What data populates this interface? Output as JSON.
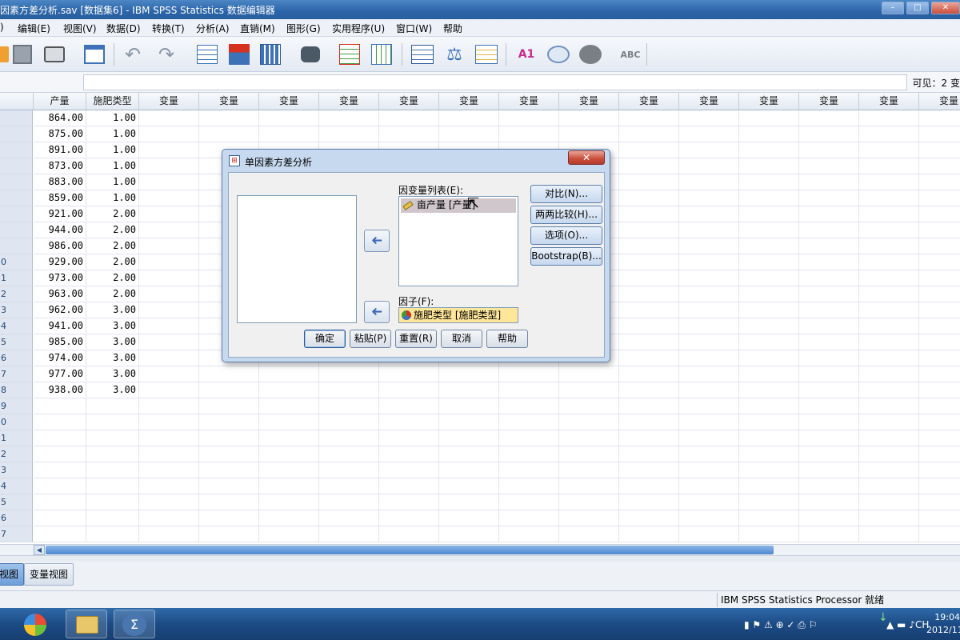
{
  "window": {
    "title": "因素方差分析.sav [数据集6] - IBM SPSS Statistics 数据编辑器",
    "controls": [
      "–",
      "□",
      "✕"
    ]
  },
  "menubar": {
    "items": [
      "编辑(E)",
      "视图(V)",
      "数据(D)",
      "转换(T)",
      "分析(A)",
      "直销(M)",
      "图形(G)",
      "实用程序(U)",
      "窗口(W)",
      "帮助"
    ],
    "partial_first": ")"
  },
  "toolbar": {
    "icons": [
      "open-icon",
      "save-icon",
      "print-icon",
      "dialog-recall-icon",
      "undo-icon",
      "redo-icon",
      "goto-case-icon",
      "goto-variable-icon",
      "variables-icon",
      "find-icon",
      "insert-cases-icon",
      "insert-variable-icon",
      "split-file-icon",
      "weight-cases-icon",
      "select-cases-icon",
      "value-labels-icon",
      "use-sets-icon",
      "show-all-icon",
      "spell-check-icon"
    ]
  },
  "cell_editor": {
    "visible_label": "可见：2 变"
  },
  "grid": {
    "columns": [
      "产量",
      "施肥类型",
      "变量",
      "变量",
      "变量",
      "变量",
      "变量",
      "变量",
      "变量",
      "变量",
      "变量",
      "变量",
      "变量",
      "变量",
      "变量",
      "变量"
    ],
    "row_labels": [
      "",
      "",
      "",
      "",
      "",
      "",
      "",
      "",
      "",
      "0",
      "1",
      "2",
      "3",
      "4",
      "5",
      "6",
      "7",
      "8",
      "9",
      "0",
      "1",
      "2",
      "3",
      "4",
      "5",
      "6",
      "7"
    ],
    "rows": [
      [
        "864.00",
        "1.00"
      ],
      [
        "875.00",
        "1.00"
      ],
      [
        "891.00",
        "1.00"
      ],
      [
        "873.00",
        "1.00"
      ],
      [
        "883.00",
        "1.00"
      ],
      [
        "859.00",
        "1.00"
      ],
      [
        "921.00",
        "2.00"
      ],
      [
        "944.00",
        "2.00"
      ],
      [
        "986.00",
        "2.00"
      ],
      [
        "929.00",
        "2.00"
      ],
      [
        "973.00",
        "2.00"
      ],
      [
        "963.00",
        "2.00"
      ],
      [
        "962.00",
        "3.00"
      ],
      [
        "941.00",
        "3.00"
      ],
      [
        "985.00",
        "3.00"
      ],
      [
        "974.00",
        "3.00"
      ],
      [
        "977.00",
        "3.00"
      ],
      [
        "938.00",
        "3.00"
      ]
    ]
  },
  "tabs": {
    "data_view": "视图",
    "variable_view": "变量视图"
  },
  "status": {
    "text": "IBM SPSS Statistics Processor 就绪"
  },
  "taskbar": {
    "tray_lang": "CH",
    "time": "19:04",
    "date": "2012/11"
  },
  "dialog": {
    "title": "单因素方差分析",
    "close": "✕",
    "dependent_label": "因变量列表(E):",
    "dependent_items": [
      "亩产量 [产量]"
    ],
    "factor_label": "因子(F):",
    "factor_value": "施肥类型 [施肥类型]",
    "side_buttons": [
      "对比(N)...",
      "两两比较(H)...",
      "选项(O)...",
      "Bootstrap(B)..."
    ],
    "bottom_buttons": [
      "确定",
      "粘贴(P)",
      "重置(R)",
      "取消",
      "帮助"
    ],
    "arrow_glyph": "➜"
  },
  "colors": {
    "title_blue": "#2b64a8",
    "dialog_frame": "#c7d9ef",
    "selected_item": "#cfc7cc",
    "factor_fill": "#ffe69a",
    "scroll_thumb": "#4f88cf"
  }
}
